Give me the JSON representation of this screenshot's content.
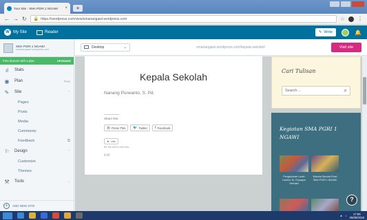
{
  "browser": {
    "tab_title": "Your Site · SMA PGRI 1 NGAWI",
    "tab_close": "×",
    "new_tab": "+",
    "url": "https://wordpress.com/view/smanangawi.wordpress.com",
    "back_icon": "arrow-left-icon",
    "forward_icon": "arrow-right-icon",
    "reload_icon": "reload-icon"
  },
  "wpbar": {
    "my_site": "My Site",
    "reader": "Reader",
    "write": "Write"
  },
  "sidebar": {
    "site_name": "SMA PGRI 1 NGAWI",
    "site_url": "smanangawi.wordpress.com",
    "plan_banner": "Free domain with a plan",
    "upgrade": "UPGRADE",
    "items": [
      {
        "label": "Stats",
        "icon": "stats-icon",
        "glyph": "ıl",
        "aux": ""
      },
      {
        "label": "Plan",
        "icon": "plan-icon",
        "glyph": "◉",
        "aux": "Free"
      },
      {
        "label": "Site",
        "icon": "pencil-icon",
        "glyph": "✎",
        "aux": "⌃"
      }
    ],
    "site_sub": [
      {
        "label": "Pages",
        "aux": ""
      },
      {
        "label": "Posts",
        "aux": ""
      },
      {
        "label": "Media",
        "aux": ""
      },
      {
        "label": "Comments",
        "aux": ""
      },
      {
        "label": "Feedback",
        "aux": "⧉"
      }
    ],
    "design": {
      "label": "Design",
      "glyph": "⚐",
      "aux": "⌃"
    },
    "design_sub": [
      {
        "label": "Customize"
      },
      {
        "label": "Themes"
      }
    ],
    "tools": {
      "label": "Tools",
      "glyph": "⚒",
      "aux": "⌄"
    },
    "add_site": "ADD NEW SITE"
  },
  "preview": {
    "device": "Desktop",
    "url": "smanangawi.wordpress.com/kepala-sekolah/",
    "visit": "Visit site"
  },
  "post": {
    "title": "Kepala Sekolah",
    "author": "Nanang Purwanto, S. Pd.",
    "share_label": "Share this:",
    "share_buttons": [
      "Press This",
      "Twitter",
      "Facebook"
    ],
    "like": "Like",
    "like_note": "Be the first to like this.",
    "edit": "Edit"
  },
  "widgets": {
    "search_title": "Cari Tulisan",
    "search_placeholder": "Search…",
    "kegiatan_title": "Kegiatan SMA PGRI 1 NGAWI",
    "captions": [
      "Pengukuhan Lurah Lombor Dr. Enyaque Sekolah",
      "Wisuda Dimulai Emel SMA PGRI 1 NGAWI"
    ]
  },
  "taskbar": {
    "time": "17:55",
    "date": "26/09/2016"
  }
}
